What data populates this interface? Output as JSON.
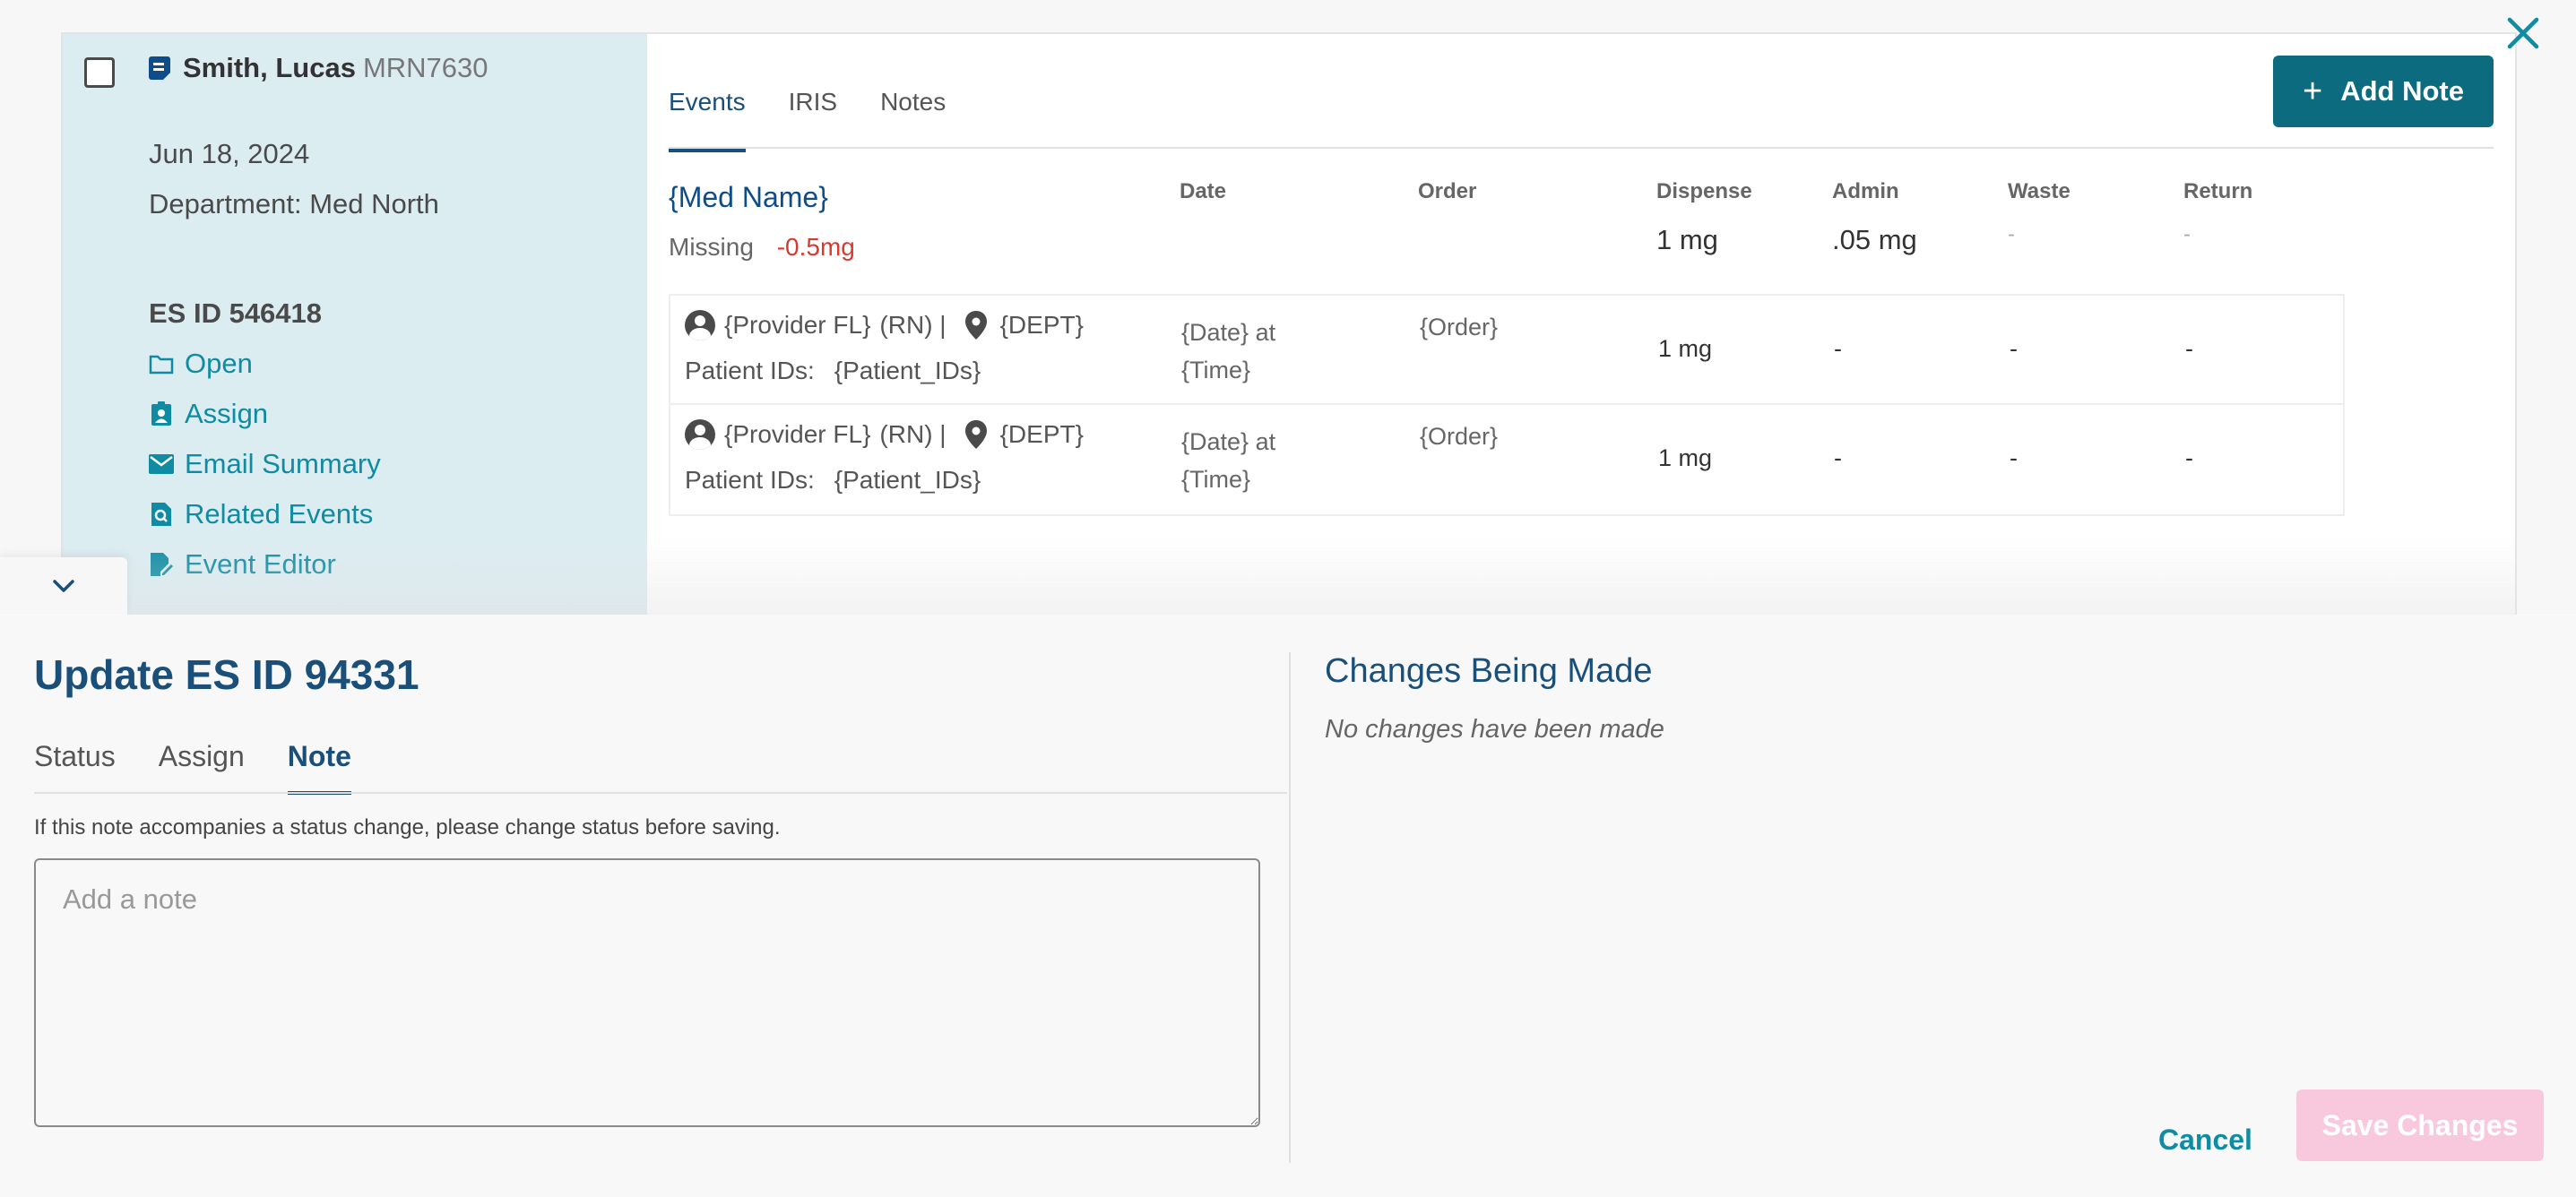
{
  "patient": {
    "name": "Smith, Lucas",
    "mrn": "MRN7630",
    "date": "Jun 18, 2024",
    "department": "Department: Med North",
    "es_id": "ES ID 546418"
  },
  "actions": {
    "open": "Open",
    "assign": "Assign",
    "email_summary": "Email Summary",
    "related_events": "Related Events",
    "event_editor": "Event Editor"
  },
  "top_tabs": [
    "Events",
    "IRIS",
    "Notes"
  ],
  "add_note_label": "Add Note",
  "add_note_plus": "+",
  "med": {
    "name": "{Med Name}",
    "missing_label": "Missing",
    "missing_value": "-0.5mg"
  },
  "columns": {
    "date": "Date",
    "order": "Order",
    "dispense": "Dispense",
    "admin": "Admin",
    "waste": "Waste",
    "return": "Return"
  },
  "summary": {
    "dispense": "1 mg",
    "admin": ".05 mg",
    "waste": "-",
    "return": "-"
  },
  "rows": [
    {
      "provider": "{Provider FL}",
      "role": "(RN) |",
      "dept": "{DEPT}",
      "patient_ids_label": "Patient IDs:",
      "patient_ids": "{Patient_IDs}",
      "date": "{Date} at {Time}",
      "order": "{Order}",
      "dispense": "1 mg",
      "admin": "-",
      "waste": "-",
      "return": "-"
    },
    {
      "provider": "{Provider FL}",
      "role": "(RN) |",
      "dept": "{DEPT}",
      "patient_ids_label": "Patient IDs:",
      "patient_ids": "{Patient_IDs}",
      "date": "{Date} at {Time}",
      "order": "{Order}",
      "dispense": "1 mg",
      "admin": "-",
      "waste": "-",
      "return": "-"
    }
  ],
  "drawer": {
    "title": "Update ES ID 94331",
    "tabs": [
      "Status",
      "Assign",
      "Note"
    ],
    "hint": "If this note accompanies a status change, please change status before saving.",
    "note_placeholder": "Add a note",
    "changes_title": "Changes Being Made",
    "changes_empty": "No changes have been made",
    "cancel": "Cancel",
    "save": "Save Changes"
  },
  "colors": {
    "primary": "#0c6b7f",
    "link": "#0f8ba3",
    "heading": "#1a4f7a",
    "negative": "#d83a2f",
    "save_disabled": "#f8c9dc",
    "left_panel_bg": "#dcedf2"
  }
}
